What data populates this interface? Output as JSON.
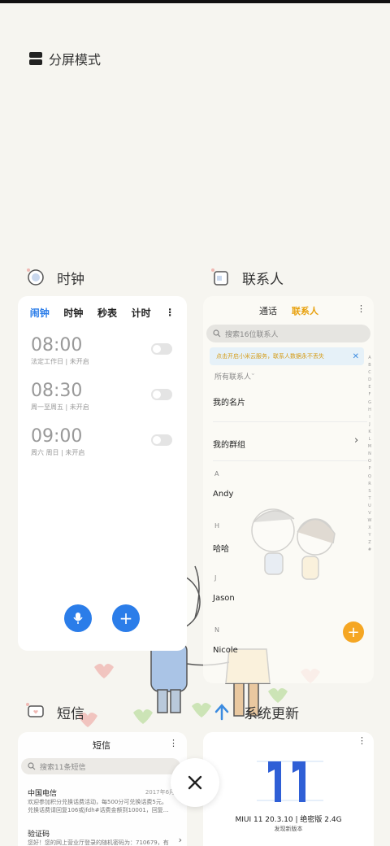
{
  "split_mode": {
    "label": "分屏模式",
    "icon": "split-screen-icon"
  },
  "clock": {
    "app_name": "时钟",
    "tabs": [
      "闹钟",
      "时钟",
      "秒表",
      "计时"
    ],
    "alarms": [
      {
        "time": "08:00",
        "desc": "法定工作日 | 未开启"
      },
      {
        "time": "08:30",
        "desc": "周一至周五 | 未开启"
      },
      {
        "time": "09:00",
        "desc": "周六 周日 | 未开启"
      }
    ]
  },
  "contacts": {
    "app_name": "联系人",
    "tabs": [
      "通话",
      "联系人"
    ],
    "search_placeholder": "搜索16位联系人",
    "banner": "点击开启小米云服务，联系人数据永不丢失",
    "filter": "所有联系人",
    "my_card": "我的名片",
    "my_group": "我的群组",
    "sections": [
      {
        "letter": "A",
        "name": "Andy"
      },
      {
        "letter": "H",
        "name": "哈哈"
      },
      {
        "letter": "J",
        "name": "Jason"
      },
      {
        "letter": "N",
        "name": "Nicole"
      }
    ],
    "alphabet": "ABCDEFGHIJKLMNOPQRSTUVWXYZ#"
  },
  "sms": {
    "app_name": "短信",
    "title": "短信",
    "search_placeholder": "搜索11条短信",
    "messages": [
      {
        "sender": "中国电信",
        "date": "2017年6月30",
        "line1": "欢迎参加积分兑换话费活动，每500分可兑换话费5元。",
        "line2": "兑换话费请回复106或jfdh#话费金额到10001，回复..."
      },
      {
        "sender": "验证码",
        "line1": "您好！您的网上营业厅登录的随机密码为：710679，有"
      }
    ]
  },
  "update": {
    "app_name": "系统更新",
    "version": "MIUI 11 20.3.10 | 绝密版 2.4G",
    "subtitle": "发现新版本"
  },
  "colors": {
    "accent_blue": "#2b7de9",
    "accent_orange": "#f5a623"
  }
}
